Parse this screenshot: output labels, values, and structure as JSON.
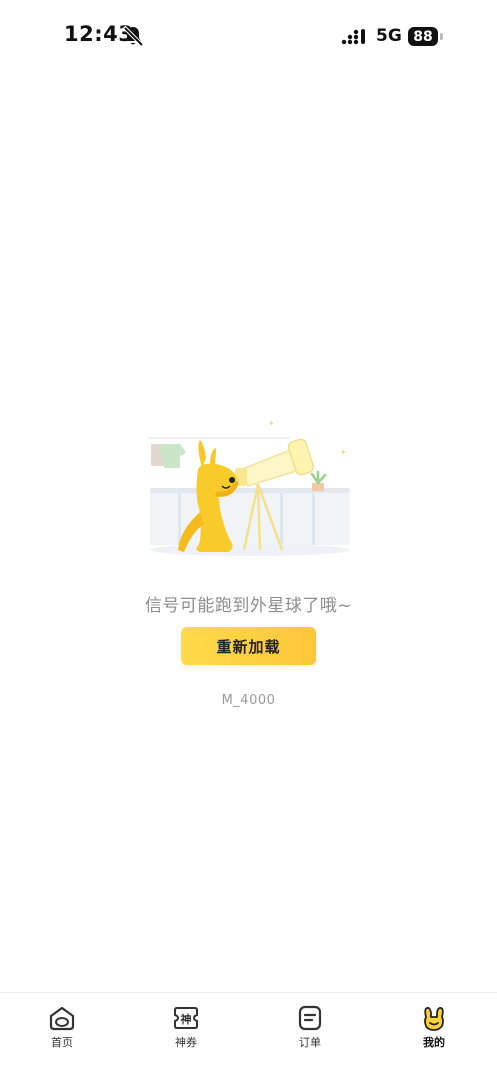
{
  "status_bar": {
    "time": "12:43",
    "network": "5G",
    "battery": "88"
  },
  "empty_state": {
    "message": "信号可能跑到外星球了哦~",
    "reload_label": "重新加载",
    "error_code": "M_4000"
  },
  "tab_bar": {
    "tabs": [
      {
        "label": "首页",
        "icon": "home-face-icon",
        "active": false
      },
      {
        "label": "神券",
        "icon": "coupon-icon",
        "active": false
      },
      {
        "label": "订单",
        "icon": "order-icon",
        "active": false
      },
      {
        "label": "我的",
        "icon": "kangaroo-icon",
        "active": true
      }
    ]
  },
  "colors": {
    "accent": "#FFD13F",
    "text_muted": "#8D8D8D"
  }
}
